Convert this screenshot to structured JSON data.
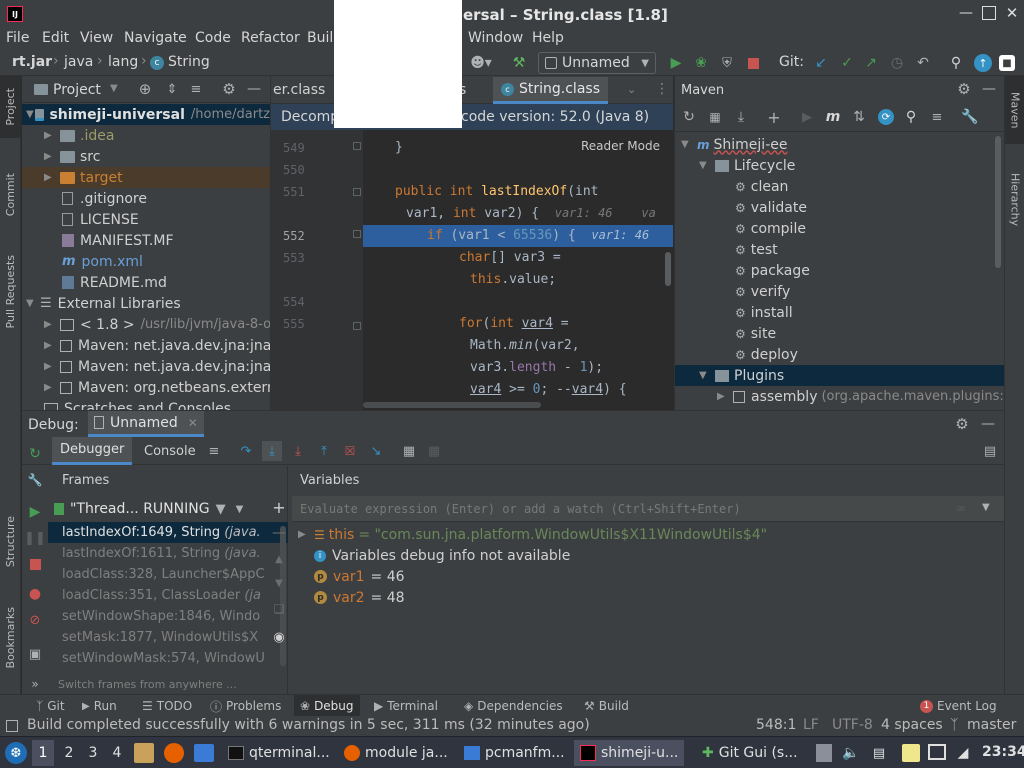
{
  "window": {
    "title": "ersal – String.class [1.8]"
  },
  "menu": [
    "File",
    "Edit",
    "View",
    "Navigate",
    "Code",
    "Refactor",
    "Buil",
    "Window",
    "Help"
  ],
  "nav": {
    "breadcrumb": [
      "rt.jar",
      "java",
      "lang",
      "String"
    ],
    "run_config": "Unnamed",
    "git_label": "Git:"
  },
  "project_panel": {
    "title": "Project",
    "items": [
      {
        "label": "shimeji-universal",
        "extra": "/home/dartz"
      },
      {
        "label": ".idea"
      },
      {
        "label": "src"
      },
      {
        "label": "target"
      },
      {
        "label": ".gitignore"
      },
      {
        "label": "LICENSE"
      },
      {
        "label": "MANIFEST.MF"
      },
      {
        "label": "pom.xml"
      },
      {
        "label": "README.md"
      },
      {
        "label": "External Libraries"
      },
      {
        "label": "< 1.8 >",
        "extra": "/usr/lib/jvm/java-8-o"
      },
      {
        "label": "Maven: net.java.dev.jna:jna:5"
      },
      {
        "label": "Maven: net.java.dev.jna:jna-p"
      },
      {
        "label": "Maven: org.netbeans.externa"
      },
      {
        "label": "Scratches and Consoles"
      }
    ]
  },
  "editor": {
    "tabs": [
      "er.class",
      "s",
      "String.class"
    ],
    "banner": "Decomp",
    "banner_right": "code version: 52.0 (Java 8)",
    "reader_mode": "Reader Mode",
    "line_numbers": [
      "549",
      "550",
      "551",
      "",
      "552",
      "553",
      "",
      "554",
      "555",
      "",
      "",
      ""
    ],
    "code": {
      "l1": "}",
      "l3_kw": "public int ",
      "l3_fn": "lastIndexOf",
      "l3_rest": "(int",
      "l4_a": "var1, ",
      "l4_kw": "int ",
      "l4_b": "var2) {",
      "l4_hint": "var1: 46    va",
      "l5_kw": "if ",
      "l5_code": "(var1 < ",
      "l5_num": "65536",
      "l5_end": ") {",
      "l5_hint": "var1: 46",
      "l6_kw": "char",
      "l6_rest": "[] var3 =",
      "l7_kw": "this",
      "l7_rest": ".value;",
      "l9_kw": "for",
      "l9_a": "(",
      "l9_kw2": "int ",
      "l9_var": "var4",
      "l9_b": " =",
      "l10_a": "Math.",
      "l10_fn": "min",
      "l10_b": "(var2,",
      "l11_a": "var3.",
      "l11_b": "length",
      "l11_c": " - ",
      "l11_num": "1",
      "l11_d": ");",
      "l12_var": "var4",
      "l12_a": " >= ",
      "l12_num": "0",
      "l12_b": "; --",
      "l12_var2": "var4",
      "l12_c": ") {"
    }
  },
  "maven": {
    "title": "Maven",
    "project": "Shimeji-ee",
    "lifecycle": "Lifecycle",
    "goals": [
      "clean",
      "validate",
      "compile",
      "test",
      "package",
      "verify",
      "install",
      "site",
      "deploy"
    ],
    "plugins": "Plugins",
    "plugin_item": "assembly",
    "plugin_extra": "(org.apache.maven.plugins:"
  },
  "right_strip": [
    "Maven",
    "Hierarchy"
  ],
  "left_strip": [
    "Project",
    "Commit",
    "Pull Requests",
    "Structure",
    "Bookmarks"
  ],
  "debug": {
    "label": "Debug:",
    "session": "Unnamed",
    "tabs": [
      "Debugger",
      "Console"
    ],
    "frames_title": "Frames",
    "variables_title": "Variables",
    "thread": "\"Thread... RUNNING",
    "frames": [
      {
        "method": "lastIndexOf:1649, String",
        "cls": "(java."
      },
      {
        "method": "lastIndexOf:1611, String",
        "cls": "(java."
      },
      {
        "method": "loadClass:328, Launcher$AppC",
        "cls": ""
      },
      {
        "method": "loadClass:351, ClassLoader",
        "cls": "(ja"
      },
      {
        "method": "setWindowShape:1846, Windo",
        "cls": ""
      },
      {
        "method": "setMask:1877, WindowUtils$X",
        "cls": ""
      },
      {
        "method": "setWindowMask:574, WindowU",
        "cls": ""
      }
    ],
    "switch_frames": "Switch frames from anywhere ...",
    "eval_placeholder": "Evaluate expression (Enter) or add a watch (Ctrl+Shift+Enter)",
    "vars": [
      {
        "name": "this",
        "value": "= \"com.sun.jna.platform.WindowUtils$X11WindowUtils$4\""
      },
      {
        "name": "",
        "value": "Variables debug info not available"
      },
      {
        "name": "var1",
        "value": "= 46"
      },
      {
        "name": "var2",
        "value": "= 48"
      }
    ]
  },
  "bottom_tabs": [
    "Git",
    "Run",
    "TODO",
    "Problems",
    "Debug",
    "Terminal",
    "Dependencies",
    "Build"
  ],
  "event_log": {
    "count": "1",
    "label": "Event Log"
  },
  "status": {
    "message": "Build completed successfully with 6 warnings in 5 sec, 311 ms (32 minutes ago)",
    "position": "548:1",
    "line_sep": "LF",
    "encoding": "UTF-8",
    "indent": "4 spaces",
    "branch": "master"
  },
  "taskbar": {
    "workspaces": [
      "1",
      "2",
      "3",
      "4"
    ],
    "tasks": [
      "qterminal...",
      "module ja...",
      "pcmanfm...",
      "shimeji-u...",
      "Git Gui (s..."
    ],
    "clock": "23:34"
  },
  "colors": {
    "accent": "#2675bf",
    "exec_line": "#2d5f9e",
    "keyword": "#cc7832",
    "function": "#ffc66d",
    "number": "#6897bb",
    "string": "#6a8759",
    "run_green": "#499c54",
    "stop_red": "#c75450"
  }
}
